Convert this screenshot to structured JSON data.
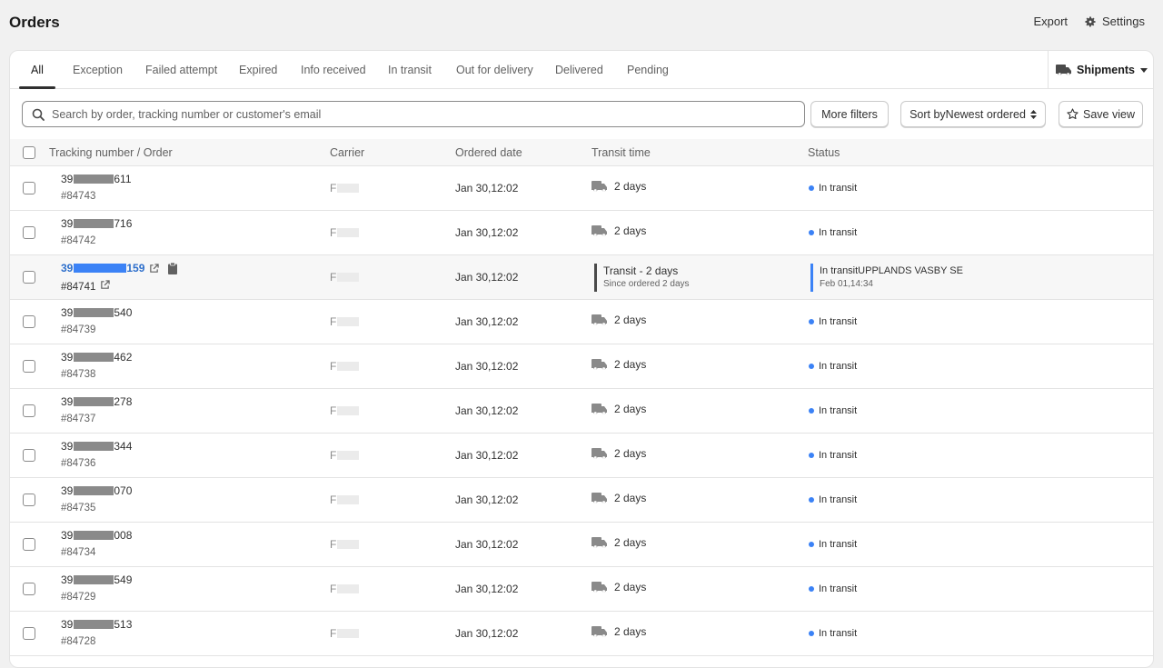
{
  "header": {
    "title": "Orders",
    "export_label": "Export",
    "settings_label": "Settings"
  },
  "tabs": [
    {
      "label": "All",
      "active": true
    },
    {
      "label": "Exception"
    },
    {
      "label": "Failed attempt"
    },
    {
      "label": "Expired"
    },
    {
      "label": "Info received"
    },
    {
      "label": "In transit"
    },
    {
      "label": "Out for delivery"
    },
    {
      "label": "Delivered"
    },
    {
      "label": "Pending"
    }
  ],
  "shipments_label": "Shipments",
  "filters": {
    "search_placeholder": "Search by order, tracking number or customer's email",
    "more_filters_label": "More filters",
    "sort_label": "Sort byNewest ordered",
    "save_view_label": "Save view"
  },
  "table": {
    "columns": [
      "Tracking number / Order",
      "Carrier",
      "Ordered date",
      "Transit time",
      "Status"
    ],
    "rows": [
      {
        "tracking_prefix": "39",
        "tracking_suffix": "611",
        "order": "#84743",
        "carrier": "F",
        "date": "Jan 30,12:02",
        "transit": "2 days",
        "status": "In transit"
      },
      {
        "tracking_prefix": "39",
        "tracking_suffix": "716",
        "order": "#84742",
        "carrier": "F",
        "date": "Jan 30,12:02",
        "transit": "2 days",
        "status": "In transit"
      },
      {
        "tracking_prefix": "39",
        "tracking_suffix": "159",
        "order": "#84741",
        "carrier": "F",
        "date": "Jan 30,12:02",
        "transit": "Transit - 2 days",
        "transit_sub": "Since ordered 2 days",
        "status": "In transitUPPLANDS VASBY SE",
        "status_sub": "Feb 01,14:34",
        "highlighted": true
      },
      {
        "tracking_prefix": "39",
        "tracking_suffix": "540",
        "order": "#84739",
        "carrier": "F",
        "date": "Jan 30,12:02",
        "transit": "2 days",
        "status": "In transit"
      },
      {
        "tracking_prefix": "39",
        "tracking_suffix": "462",
        "order": "#84738",
        "carrier": "F",
        "date": "Jan 30,12:02",
        "transit": "2 days",
        "status": "In transit"
      },
      {
        "tracking_prefix": "39",
        "tracking_suffix": "278",
        "order": "#84737",
        "carrier": "F",
        "date": "Jan 30,12:02",
        "transit": "2 days",
        "status": "In transit"
      },
      {
        "tracking_prefix": "39",
        "tracking_suffix": "344",
        "order": "#84736",
        "carrier": "F",
        "date": "Jan 30,12:02",
        "transit": "2 days",
        "status": "In transit"
      },
      {
        "tracking_prefix": "39",
        "tracking_suffix": "070",
        "order": "#84735",
        "carrier": "F",
        "date": "Jan 30,12:02",
        "transit": "2 days",
        "status": "In transit"
      },
      {
        "tracking_prefix": "39",
        "tracking_suffix": "008",
        "order": "#84734",
        "carrier": "F",
        "date": "Jan 30,12:02",
        "transit": "2 days",
        "status": "In transit"
      },
      {
        "tracking_prefix": "39",
        "tracking_suffix": "549",
        "order": "#84729",
        "carrier": "F",
        "date": "Jan 30,12:02",
        "transit": "2 days",
        "status": "In transit"
      },
      {
        "tracking_prefix": "39",
        "tracking_suffix": "513",
        "order": "#84728",
        "carrier": "F",
        "date": "Jan 30,12:02",
        "transit": "2 days",
        "status": "In transit"
      }
    ]
  },
  "colors": {
    "status_dot": "#3b82f6",
    "link": "#2c6ecb"
  }
}
